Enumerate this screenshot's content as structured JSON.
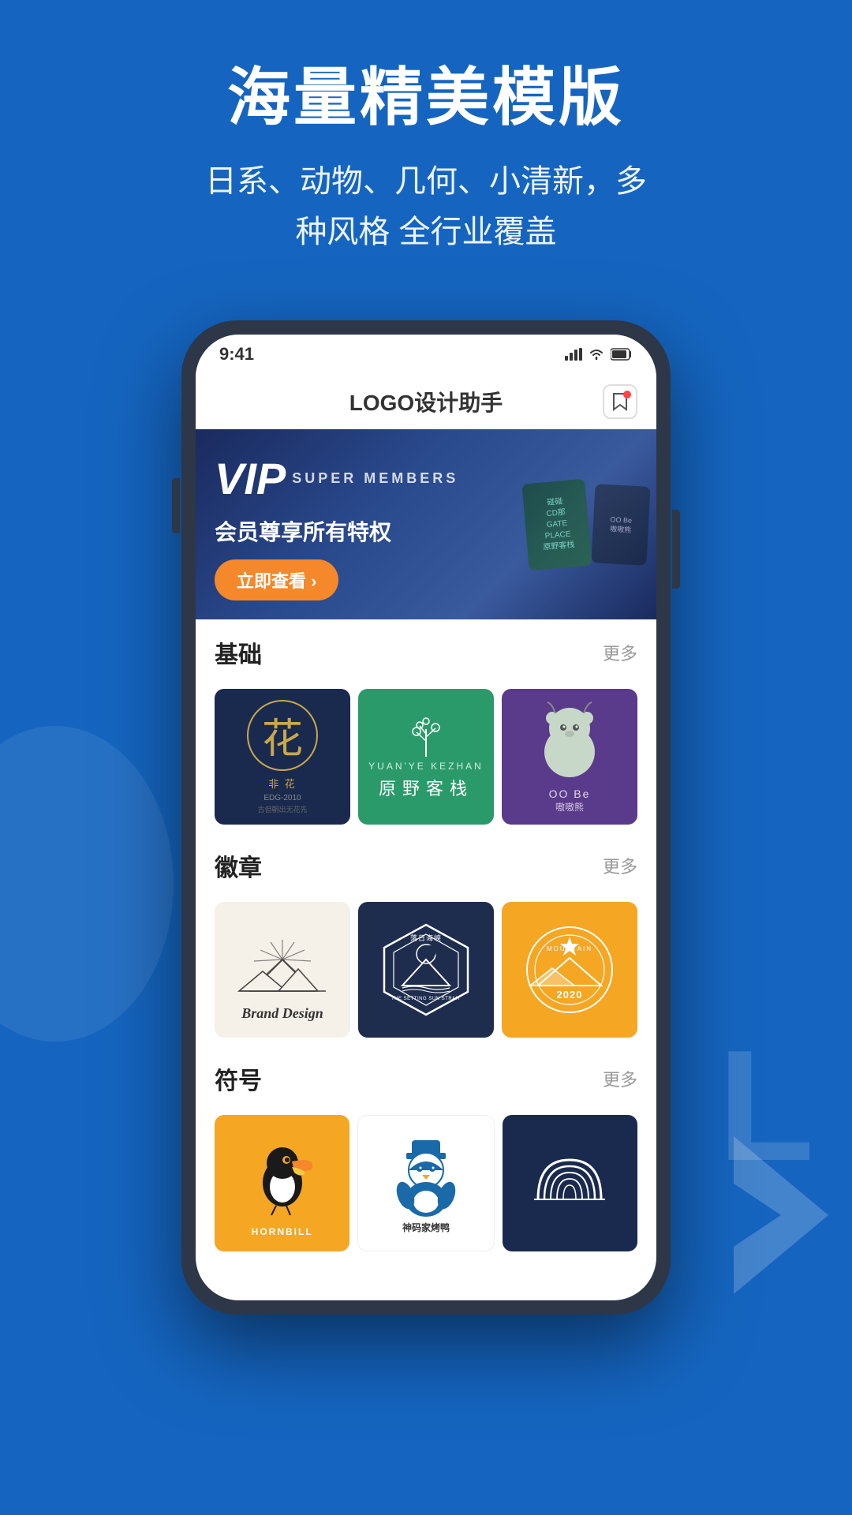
{
  "header": {
    "title": "海量精美模版",
    "subtitle_line1": "日系、动物、几何、小清新，多",
    "subtitle_line2": "种风格 全行业覆盖"
  },
  "app": {
    "title": "LOGO设计助手"
  },
  "vip": {
    "vip_label": "VIP",
    "super_label": "SUPER  MEMBERS",
    "slogan": "会员尊享所有特权",
    "cta": "立即查看 ›"
  },
  "sections": [
    {
      "id": "basic",
      "title": "基础",
      "more_label": "更多"
    },
    {
      "id": "badge",
      "title": "徽章",
      "more_label": "更多"
    },
    {
      "id": "symbol",
      "title": "符号",
      "more_label": "更多"
    }
  ],
  "basic_templates": [
    {
      "id": "flower",
      "name": "花非花",
      "style": "dark-blue",
      "sub": "EDG-2010"
    },
    {
      "id": "yuanye",
      "name": "原野客栈",
      "name_pinyin": "YUAN'YE KEZHAN",
      "style": "teal"
    },
    {
      "id": "animal",
      "name": "嗷嗷熊",
      "style": "purple"
    }
  ],
  "badge_templates": [
    {
      "id": "brand-design",
      "name": "Brand Design",
      "style": "cream"
    },
    {
      "id": "luori-haixia",
      "name": "落日海峡",
      "name_en": "THE SETTING SUN STRAIT",
      "style": "navy"
    },
    {
      "id": "mountain-2020",
      "name": "MOUNTAIN",
      "year": "2020",
      "style": "yellow"
    }
  ],
  "symbol_templates": [
    {
      "id": "hornbill",
      "name": "HORNBILL",
      "style": "orange"
    },
    {
      "id": "penguin",
      "name": "神码家烤鸭",
      "style": "white"
    },
    {
      "id": "concentric",
      "name": "",
      "style": "navy"
    }
  ],
  "colors": {
    "background": "#1565C0",
    "phone_frame": "#2d3748",
    "vip_orange": "#f5882a",
    "section_title": "#222222",
    "more_color": "#999999"
  }
}
